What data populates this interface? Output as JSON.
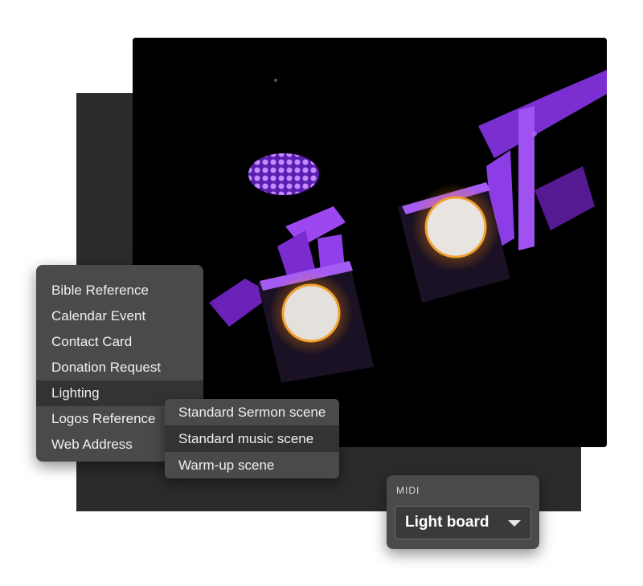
{
  "context_menu": {
    "items": [
      {
        "label": "Bible Reference"
      },
      {
        "label": "Calendar Event"
      },
      {
        "label": "Contact Card"
      },
      {
        "label": "Donation Request"
      },
      {
        "label": "Lighting",
        "selected": true
      },
      {
        "label": "Logos Reference"
      },
      {
        "label": "Web Address"
      }
    ]
  },
  "submenu": {
    "items": [
      {
        "label": "Standard Sermon scene"
      },
      {
        "label": "Standard music scene",
        "selected": true
      },
      {
        "label": "Warm-up scene"
      }
    ]
  },
  "midi": {
    "label": "MIDI",
    "selected_value": "Light board",
    "icon": "chevron-down-icon"
  },
  "colors": {
    "menu_bg": "#4a4a4a",
    "menu_active_bg": "#333333",
    "backdrop": "#2b2b2b",
    "accent_purple": "#8a2be2",
    "accent_amber": "#f0a030"
  }
}
